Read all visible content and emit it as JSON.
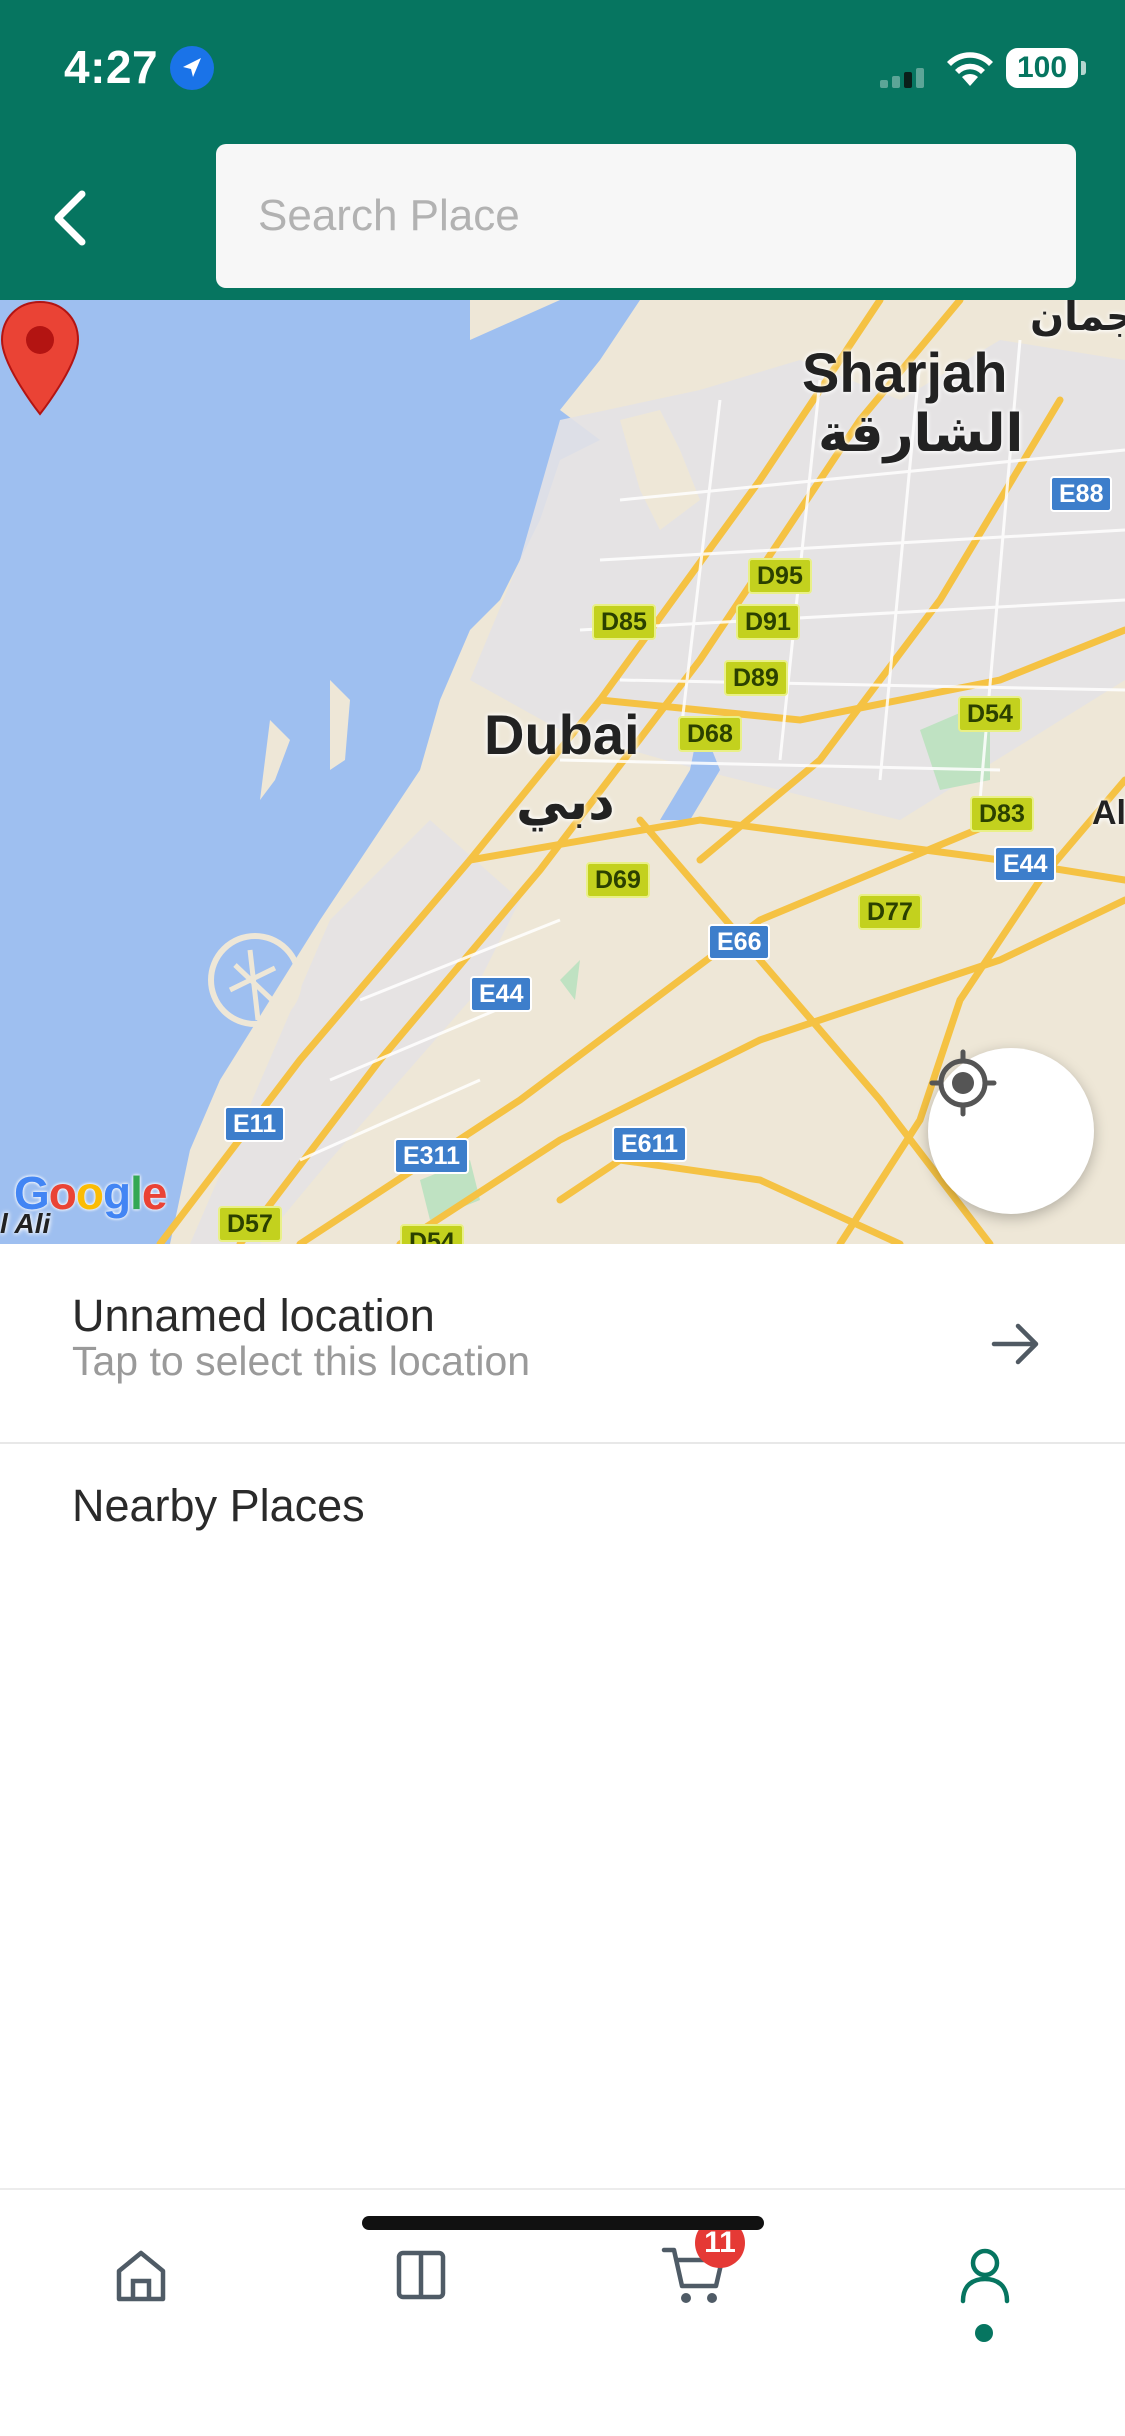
{
  "status_bar": {
    "time": "4:27",
    "battery": "100"
  },
  "header": {
    "search_placeholder": "Search Place",
    "back_icon": "chevron-left-icon"
  },
  "map": {
    "city_labels": {
      "sharjah_en": "Sharjah",
      "sharjah_ar": "الشارقة",
      "dubai_en": "Dubai",
      "dubai_ar": "دبي",
      "ajman_ar": "عجمان",
      "al_partial": "Al",
      "ali_partial": "l Ali"
    },
    "road_shields": [
      "E88",
      "D95",
      "D85",
      "D91",
      "D89",
      "D68",
      "D54",
      "D83",
      "E44",
      "D69",
      "D77",
      "E66",
      "E44",
      "E11",
      "E311",
      "E611",
      "D57",
      "D54"
    ],
    "attribution": "Google",
    "colors": {
      "water": "#9ebff0",
      "land": "#eee7d7",
      "road": "#f5c243",
      "pin": "#ea4335"
    }
  },
  "location_row": {
    "title": "Unnamed location",
    "subtitle": "Tap to select this location"
  },
  "nearby": {
    "label": "Nearby Places"
  },
  "bottom_nav": {
    "cart_badge": "11",
    "items": [
      "home-icon",
      "catalog-icon",
      "cart-icon",
      "profile-icon"
    ],
    "accent": "#067560"
  }
}
